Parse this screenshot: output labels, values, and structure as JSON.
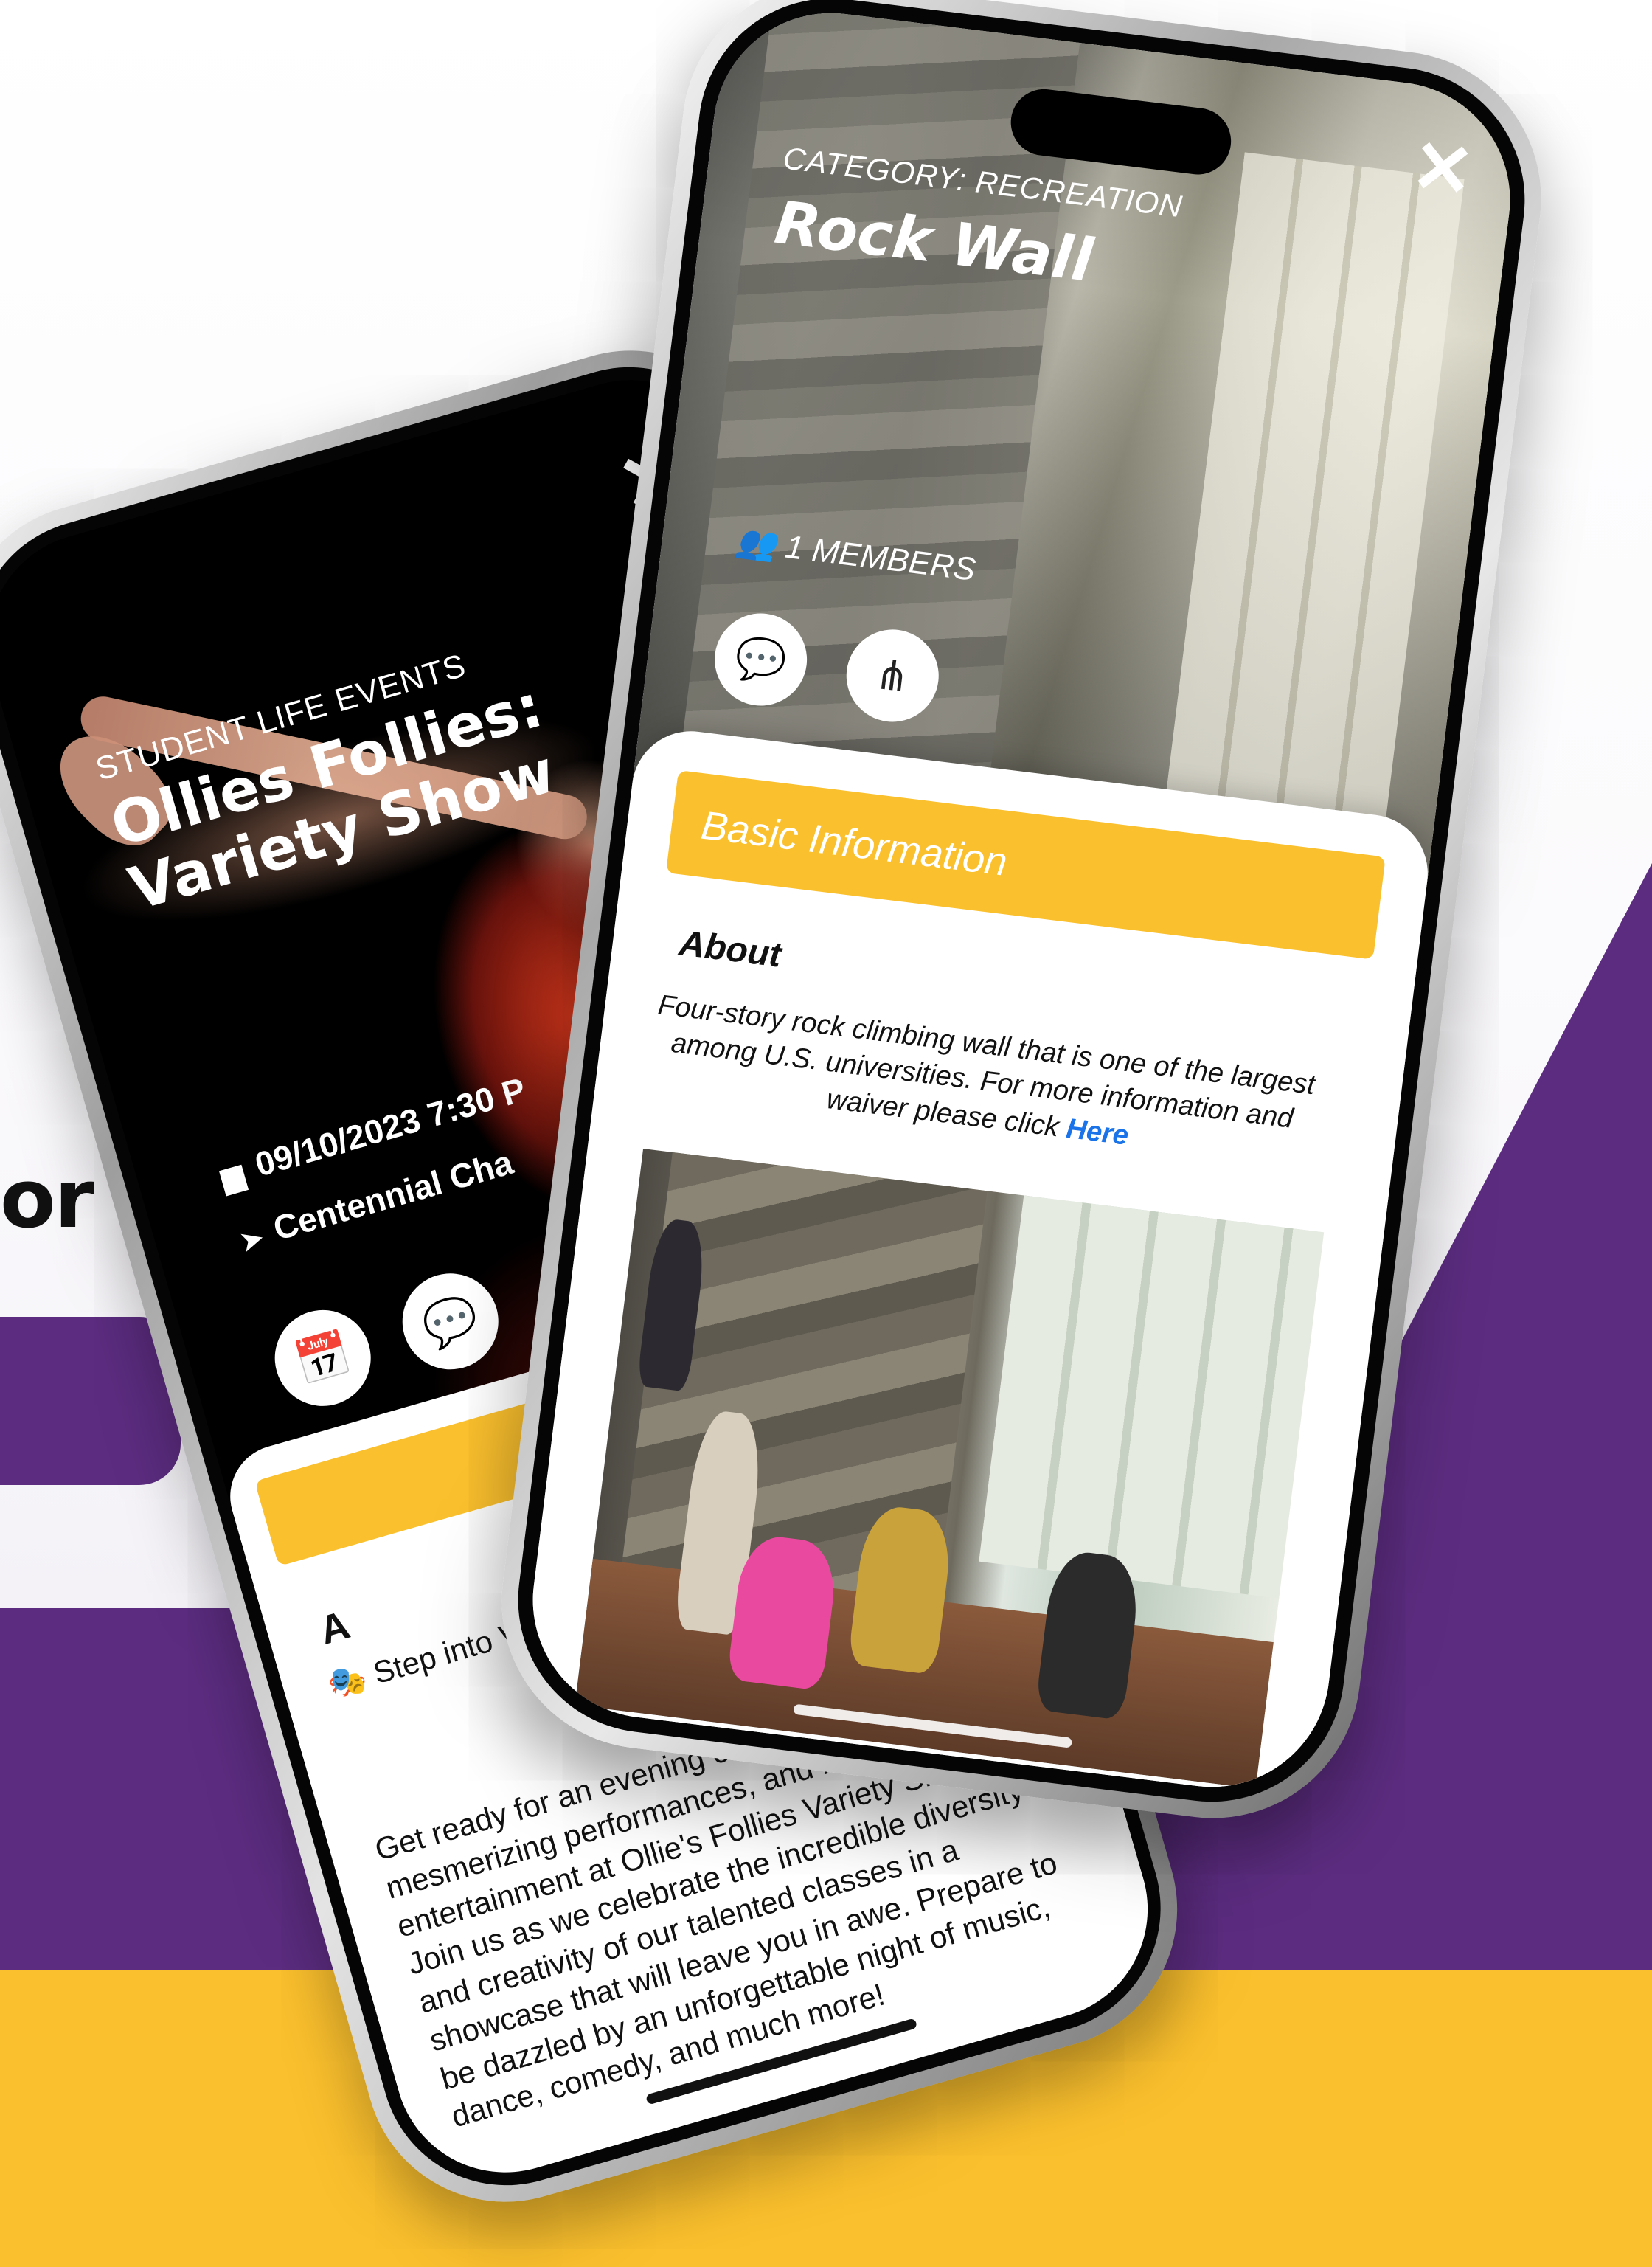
{
  "cta": {
    "text": "or"
  },
  "back_phone": {
    "close_icon": "close-icon",
    "category": "STUDENT LIFE EVENTS",
    "title": "Ollies Follies: Variety Show",
    "date": "09/10/2023 7:30 P",
    "location": "Centennial Cha",
    "buttons": [
      "calendar-plus-icon",
      "chat-icon"
    ],
    "about_label": "A",
    "intro": "🎭 Step into Variety Show! 🌟",
    "description": "Get ready for an evening of extraordinary talent, mesmerizing performances, and non-stop entertainment at Ollie's Follies Variety Show! Join us as we celebrate the incredible diversity and creativity of our talented classes in a showcase that will leave you in awe. Prepare to be dazzled by an unforgettable night of music, dance, comedy, and much more!"
  },
  "front_phone": {
    "close_icon": "close-icon",
    "category": "CATEGORY: RECREATION",
    "title": "Rock Wall",
    "members": "1 MEMBERS",
    "buttons": [
      "chat-icon",
      "share-icon"
    ],
    "section_title": "Basic Information",
    "about_label": "About",
    "about_text": "Four-story rock climbing wall that is one of the largest among U.S. universities. For more information and waiver please click",
    "link_text": "Here"
  },
  "colors": {
    "purple": "#5c2c80",
    "yellow": "#fbc02d",
    "link": "#1a73e8"
  }
}
